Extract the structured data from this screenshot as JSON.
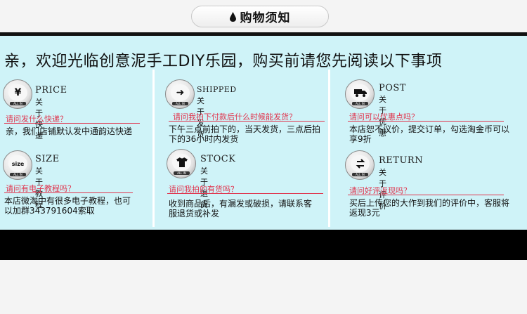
{
  "header": {
    "title": "购物须知",
    "drop_icon": "drop-icon"
  },
  "headline": "亲，欢迎光临创意泥手工DIY乐园，购买前请您先阅读以下事项",
  "colors": {
    "panel": "#cff3f8",
    "question": "#e0344d",
    "bar": "#000000"
  },
  "cells": {
    "price": {
      "en": "PRICE",
      "cn": "关于快递",
      "question": "请问发什么快递？",
      "answer": "亲，我们店铺默认发中通韵达快递",
      "icon": "yuan-icon",
      "icon_text": "¥"
    },
    "shipped": {
      "en": "SHIPPED",
      "cn": "关于发货",
      "question": "请问我拍下付款后什么时候能发货？",
      "answer": "下午三点前拍下的，当天发货，三点后拍下的36小时内发货",
      "icon": "arrow-right-icon",
      "icon_text": "➜"
    },
    "post": {
      "en": "POST",
      "cn": "关于优惠",
      "question": "请问可以优惠点吗？",
      "answer": "本店恕不议价，提交订单，勾选淘金币可以享9折",
      "icon": "truck-icon",
      "icon_text": "🚚"
    },
    "size": {
      "en": "SIZE",
      "cn": "关于教程",
      "question": "请问有电子教程吗？",
      "answer": "本店微淘中有很多电子教程，也可以加群343791604索取",
      "icon": "size-icon",
      "icon_text": "size"
    },
    "stock": {
      "en": "STOCK",
      "cn": "关于退货",
      "question": "请问我拍的有货吗？",
      "answer": "收到商品后，有漏发或破损，请联系客服退货或补发",
      "icon": "shirt-icon",
      "icon_text": "👕"
    },
    "return": {
      "en": "RETURN",
      "cn": "关于评价",
      "question": "请问好评返现吗？",
      "answer": "买后上传您的大作到我们的评价中，客服将返现3元",
      "icon": "return-icon",
      "icon_text": "⇋"
    }
  },
  "icon_base_label": "ALL IN"
}
